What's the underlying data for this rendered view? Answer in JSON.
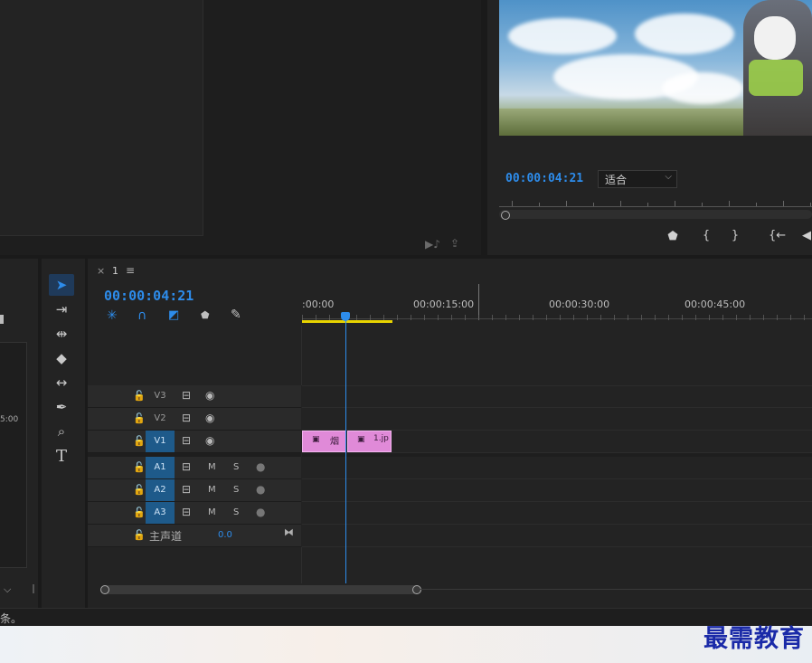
{
  "program": {
    "timecode": "00:00:04:21",
    "fit_label": "适合",
    "buttons": [
      "marker-icon",
      "mark-in-icon",
      "mark-out-icon",
      "go-to-in-icon",
      "step-back-icon"
    ]
  },
  "source": {
    "icons": [
      "export-audio-icon",
      "insert-icon"
    ]
  },
  "left_fragment": {
    "timecode": "5:00"
  },
  "timeline": {
    "close": "×",
    "sequence_name": "1",
    "menu_icon": "≡",
    "timecode": "00:00:04:21",
    "ruler_labels": [
      ":00:00",
      "00:00:15:00",
      "00:00:30:00",
      "00:00:45:00"
    ],
    "tracks": [
      {
        "label": "V3",
        "type": "video",
        "active": false
      },
      {
        "label": "V2",
        "type": "video",
        "active": false
      },
      {
        "label": "V1",
        "type": "video",
        "active": true
      },
      {
        "label": "A1",
        "type": "audio",
        "active": true
      },
      {
        "label": "A2",
        "type": "audio",
        "active": true
      },
      {
        "label": "A3",
        "type": "audio",
        "active": true
      }
    ],
    "mute_label": "M",
    "solo_label": "S",
    "master": {
      "label": "主声道",
      "value": "0.0"
    },
    "clips": [
      {
        "label": "烟",
        "track": "V1"
      },
      {
        "label": "1.jp",
        "track": "V1"
      }
    ]
  },
  "statusbar": {
    "text": "条。"
  },
  "watermark": "最需教育",
  "colors": {
    "accent": "#2d8ceb",
    "clip": "#e08ad8",
    "track_active": "#1e5a8a",
    "work_area": "#e8d400"
  }
}
